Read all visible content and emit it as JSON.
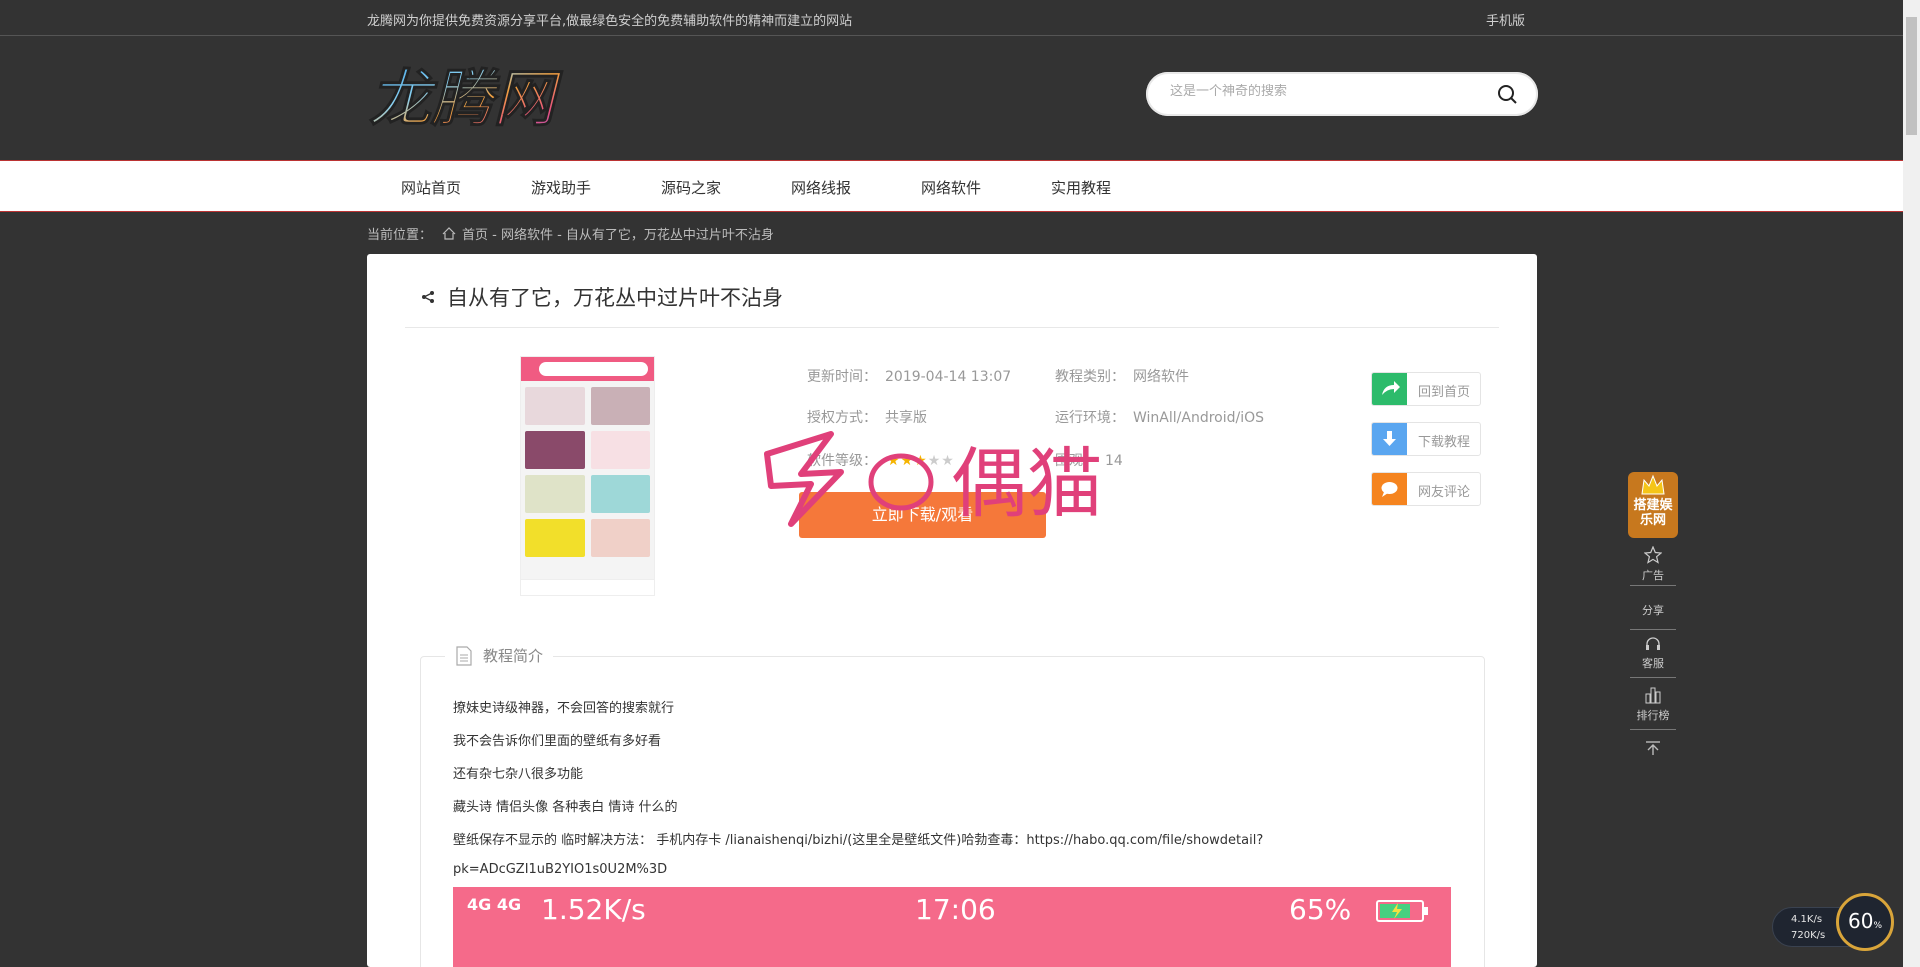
{
  "topbar": {
    "notice": "龙腾网为你提供免费资源分享平台,做最绿色安全的免费辅助软件的精神而建立的网站",
    "mobile_link": "手机版"
  },
  "header": {
    "logo_text": "龙腾网",
    "search_placeholder": "这是一个神奇的搜索"
  },
  "nav": {
    "items": [
      "网站首页",
      "游戏助手",
      "源码之家",
      "网络线报",
      "网络软件",
      "实用教程"
    ]
  },
  "breadcrumb": {
    "prefix": "当前位置：",
    "path": "首页 - 网络软件 - 自从有了它，万花丛中过片叶不沾身"
  },
  "article": {
    "title": "自从有了它，万花丛中过片叶不沾身",
    "info": {
      "update_label": "更新时间：",
      "update_value": "2019-04-14 13:07",
      "category_label": "教程类别：",
      "category_value": "网络软件",
      "license_label": "授权方式：",
      "license_value": "共享版",
      "env_label": "运行环境：",
      "env_value": "WinAll/Android/iOS",
      "rating_label": "软件等级：",
      "rating": 3,
      "rating_max": 5,
      "views_label": "围观：",
      "views_value": "14"
    },
    "download_button": "立即下载/观看",
    "watermark_text": "偶猫",
    "side_actions": [
      "回到首页",
      "下载教程",
      "网友评论"
    ],
    "colors": {
      "home": "#2dbb6b",
      "download": "#5aa6f0",
      "comment": "#f5841f"
    }
  },
  "intro": {
    "legend": "教程简介",
    "lines": [
      "撩妹史诗级神器，不会回答的搜索就行",
      "我不会告诉你们里面的壁纸有多好看",
      "还有杂七杂八很多功能",
      "藏头诗 情侣头像 各种表白 情诗 什么的",
      "壁纸保存不显示的  临时解决方法：  手机内存卡  /lianaishenqi/bizhi/(这里全是壁纸文件)哈勃查毒：https://habo.qq.com/file/showdetail?",
      "pk=ADcGZI1uB2YIO1s0U2M%3D"
    ],
    "screenshot": {
      "network": "4G 4G",
      "speed": "1.52K/s",
      "time": "17:06",
      "battery": "65%"
    }
  },
  "float_bar": {
    "badge": "搭建娱乐网",
    "items": [
      "广告",
      "分享",
      "客服",
      "排行榜"
    ]
  },
  "net_meter": {
    "up": "4.1K/s",
    "down": "720K/s",
    "percent": "60",
    "unit": "%"
  }
}
